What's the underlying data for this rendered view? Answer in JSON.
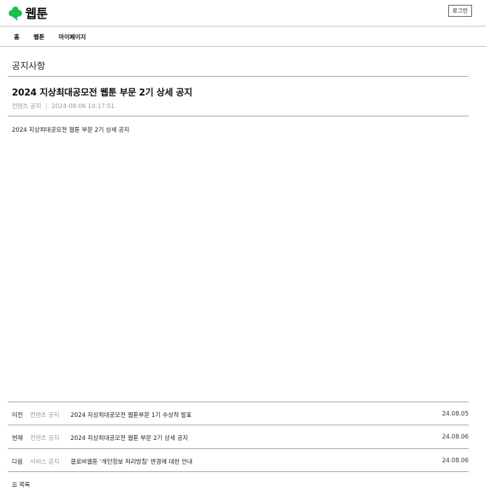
{
  "header": {
    "logo_text": "웹툰",
    "logo_color": "#19c04c",
    "login_label": "로그인"
  },
  "nav": {
    "items": [
      {
        "label": "홈"
      },
      {
        "label": "웹툰"
      },
      {
        "label": "마이페이지"
      }
    ]
  },
  "page": {
    "title": "공지사항"
  },
  "post": {
    "title": "2024 지상최대공모전 웹툰 부문 2기 상세 공지",
    "category": "컨텐츠 공지",
    "separator": "|",
    "datetime": "2024-08-06 10:17:51",
    "body": "2024 지상최대공모전 웹툰 부문 2기 상세 공지"
  },
  "post_nav": [
    {
      "dir": "이전",
      "category": "컨텐츠 공지",
      "title": "2024 지상최대공모전 웹툰부문 1기 수상작 발표",
      "date": "24.08.05"
    },
    {
      "dir": "현재",
      "category": "컨텐츠 공지",
      "title": "2024 지상최대공모전 웹툰 부문 2기 상세 공지",
      "date": "24.08.06"
    },
    {
      "dir": "다음",
      "category": "서비스 공지",
      "title": "클로버웹툰 '개인정보 처리방침' 변경에 대한 안내",
      "date": "24.08.06"
    }
  ],
  "list_link": {
    "icon": "menu-icon",
    "label": "목록"
  }
}
